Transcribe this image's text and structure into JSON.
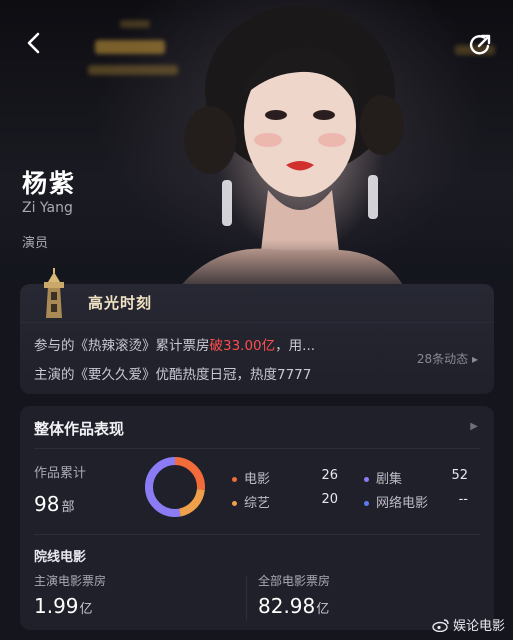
{
  "profile": {
    "name": "杨紫",
    "name_en": "Zi Yang",
    "role": "演员"
  },
  "highlights": {
    "title": "高光时刻",
    "line1_prefix": "参与的《热辣滚烫》累计票房",
    "line1_highlight": "破33.00亿",
    "line1_suffix": "，用...",
    "line2": "主演的《要久久爱》优酷热度日冠，热度7777",
    "more_label": "28条动态 ▸"
  },
  "works": {
    "title": "整体作品表现",
    "total_label": "作品累计",
    "total_value": "98",
    "total_unit": "部",
    "legend": [
      {
        "label": "电影",
        "value": "26",
        "color": "#f26b3a"
      },
      {
        "label": "剧集",
        "value": "52",
        "color": "#8b7cf6"
      },
      {
        "label": "综艺",
        "value": "20",
        "color": "#f0a04a"
      },
      {
        "label": "网络电影",
        "value": "--",
        "color": "#5b7cf0"
      }
    ],
    "donut_fractions": {
      "movie": 0.265,
      "series": 0.531,
      "variety": 0.204
    }
  },
  "cinema": {
    "title": "院线电影",
    "lead_label": "主演电影票房",
    "lead_value": "1.99",
    "lead_unit": "亿",
    "all_label": "全部电影票房",
    "all_value": "82.98",
    "all_unit": "亿"
  },
  "watermark": "娱论电影"
}
